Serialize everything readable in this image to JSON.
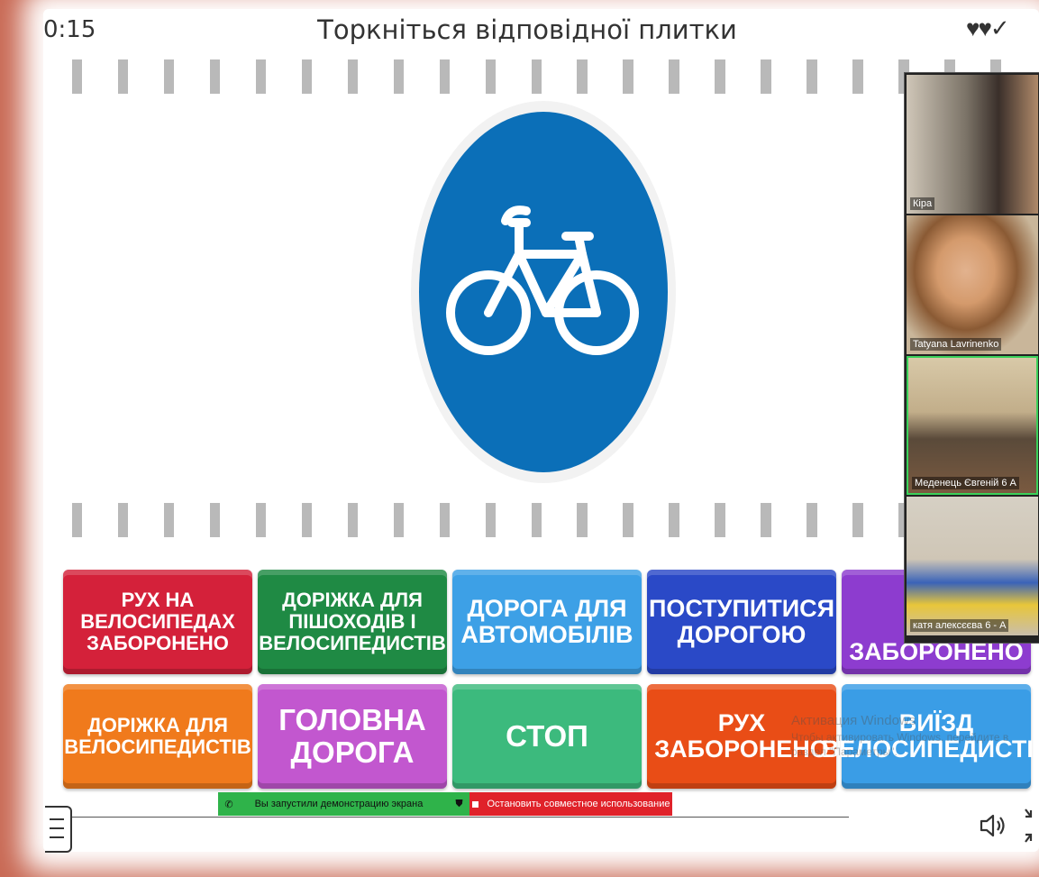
{
  "header": {
    "timer": "0:15",
    "title": "Торкніться відповідної плитки",
    "lives": "♥♥✓"
  },
  "question": {
    "sign_icon": "bicycle-icon",
    "sign_color": "#0b6fb8"
  },
  "tiles": [
    {
      "label": "РУХ НА ВЕЛОСИПЕДАХ ЗАБОРОНЕНО",
      "color": "#d4213a"
    },
    {
      "label": "ДОРІЖКА ДЛЯ ПІШОХОДІВ І ВЕЛОСИПЕДИСТІВ",
      "color": "#1f8a44"
    },
    {
      "label": "ДОРОГА ДЛЯ АВТОМОБІЛІВ",
      "color": "#3da0e6"
    },
    {
      "label": "ПОСТУПИТИСЯ ДОРОГОЮ",
      "color": "#2a49c7"
    },
    {
      "label": "ЗАБОРОНЕНО",
      "color": "#8d3ccf"
    },
    {
      "label": "ДОРІЖКА ДЛЯ ВЕЛОСИПЕДИСТІВ",
      "color": "#f07a1c"
    },
    {
      "label": "ГОЛОВНА ДОРОГА",
      "color": "#c257cf"
    },
    {
      "label": "СТОП",
      "color": "#3cba7d"
    },
    {
      "label": "РУХ ЗАБОРОНЕНО",
      "color": "#e94d16"
    },
    {
      "label": "ВИЇЗД ВЕЛОСИПЕДИСТІВ",
      "color": "#3a9de6"
    }
  ],
  "participants": [
    {
      "name": "Кіра"
    },
    {
      "name": "Tatyana Lavrinenko"
    },
    {
      "name": "Меденець Євгеній 6 А"
    },
    {
      "name": "катя алексєєва 6 - А"
    }
  ],
  "screen_share": {
    "status": "Вы запустили демонстрацию экрана",
    "stop": "Остановить совместное использование"
  },
  "watermark": {
    "line1": "Активация Windows",
    "line2": "Чтобы активировать Windows, перейдите в",
    "line3": "раздел \"Параметры\"."
  },
  "controls": {
    "menu_icon": "menu-icon",
    "sound_icon": "speaker-icon",
    "fullscreen_icon": "exit-fullscreen-icon"
  }
}
